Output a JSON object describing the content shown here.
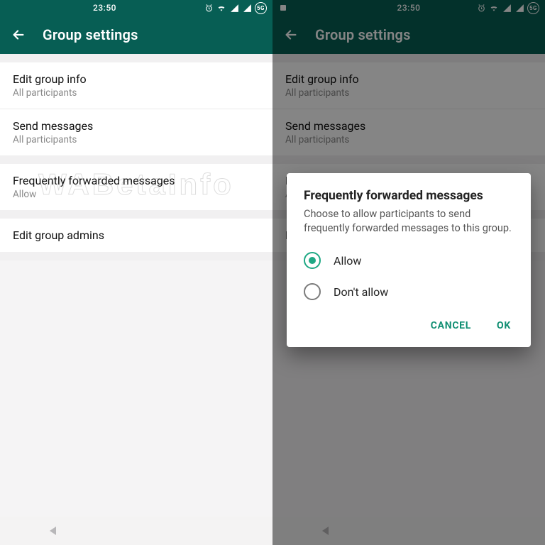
{
  "status": {
    "time": "23:50",
    "badge": "5G"
  },
  "header": {
    "title": "Group settings"
  },
  "rows": {
    "edit_info": {
      "title": "Edit group info",
      "sub": "All participants"
    },
    "send_msgs": {
      "title": "Send messages",
      "sub": "All participants"
    },
    "fwd": {
      "title": "Frequently forwarded messages",
      "sub": "Allow"
    },
    "admins": {
      "title": "Edit group admins"
    }
  },
  "dialog": {
    "title": "Frequently forwarded messages",
    "body": "Choose to allow participants to send frequently forwarded messages to this group.",
    "allow": "Allow",
    "dont_allow": "Don't allow",
    "cancel": "CANCEL",
    "ok": "OK"
  },
  "watermark": "WABetaInfo",
  "watermark2": "@WABetaInfo"
}
